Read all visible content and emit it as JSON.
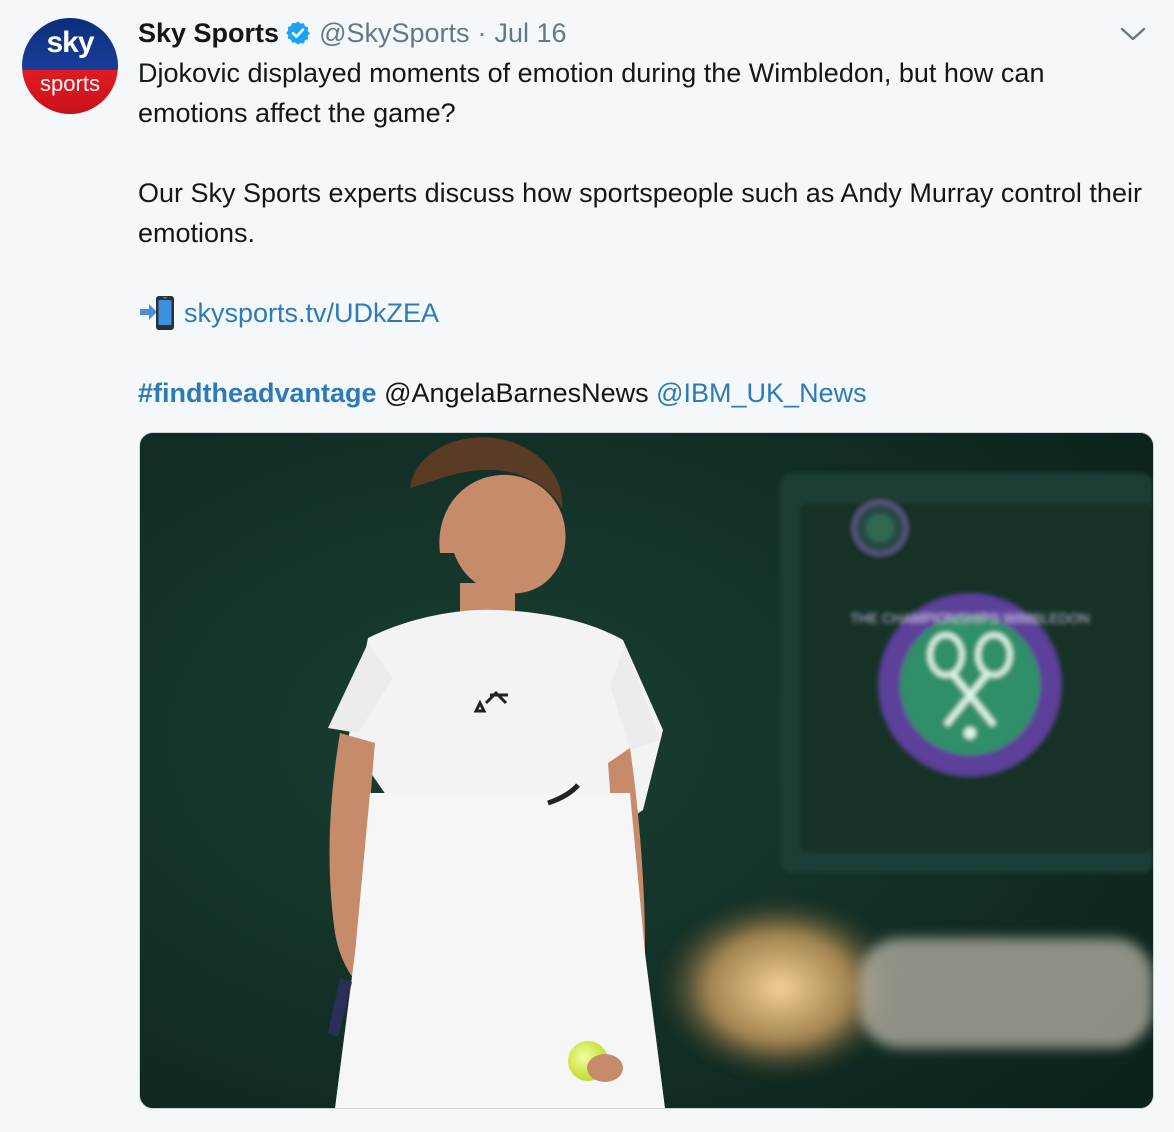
{
  "tweet": {
    "avatar": {
      "line1": "sky",
      "line2": "sports"
    },
    "author_name": "Sky Sports",
    "handle": "@SkySports",
    "separator": "·",
    "date": "Jul 16",
    "text_line_1": "Djokovic displayed moments of emotion during the Wimbledon, but how can emotions affect the game?",
    "text_line_2": "Our Sky Sports experts discuss how sportspeople such as Andy Murray control their emotions.",
    "link": "skysports.tv/UDkZEA",
    "hashtag": "#findtheadvantage",
    "mention_1": "@AngelaBarnesNews",
    "mention_2": "@IBM_UK_News",
    "media": {
      "logo_text": "THE CHAMPIONSHIPS WIMBLEDON"
    }
  },
  "colors": {
    "background": "#f5f8fa",
    "link": "#2b7bb9",
    "secondary_text": "#657786",
    "verified": "#1da1f2"
  },
  "icons": [
    "verified-badge-icon",
    "chevron-down-icon",
    "mobile-phone-arrow-icon"
  ]
}
